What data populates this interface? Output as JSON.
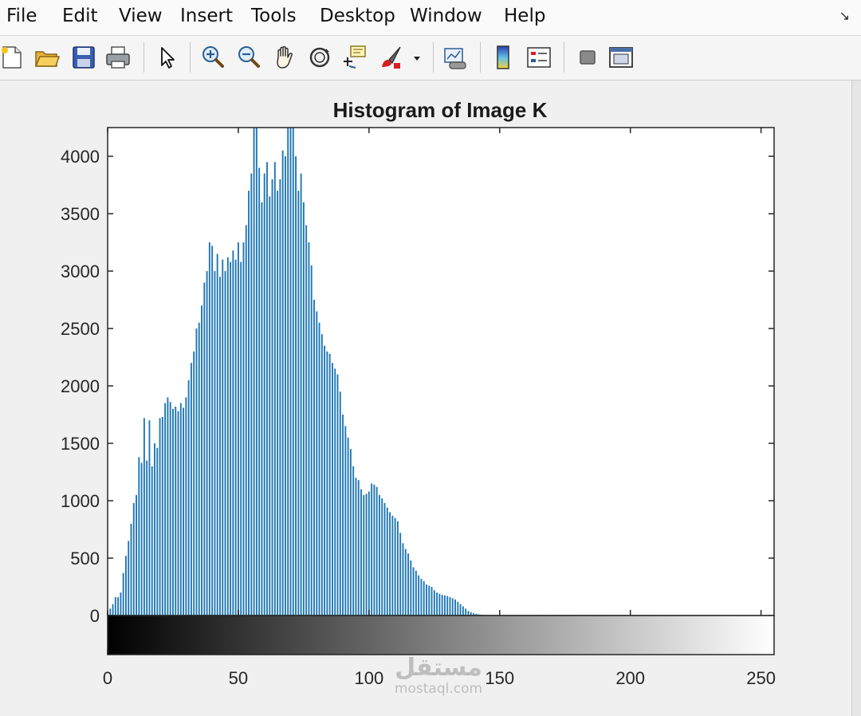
{
  "menubar": {
    "items": [
      "File",
      "Edit",
      "View",
      "Insert",
      "Tools",
      "Desktop",
      "Window",
      "Help"
    ],
    "dock_glyph": "↘"
  },
  "toolbar": {
    "icons": [
      "new-figure-icon",
      "open-file-icon",
      "save-icon",
      "print-icon",
      "edit-plot-arrow-icon",
      "zoom-in-icon",
      "zoom-out-icon",
      "pan-hand-icon",
      "rotate-3d-icon",
      "data-cursor-icon",
      "brush-icon",
      "brush-dropdown-icon",
      "link-plot-icon",
      "insert-colorbar-icon",
      "insert-legend-icon",
      "hide-plot-tools-icon",
      "show-plot-tools-icon"
    ]
  },
  "plot": {
    "title": "Histogram of Image K",
    "bar_color": "#1f77b4",
    "colorbar": "gray"
  },
  "chart_data": {
    "type": "bar",
    "title": "Histogram of Image K",
    "xlabel": "",
    "ylabel": "",
    "xlim": [
      0,
      255
    ],
    "ylim": [
      0,
      4250
    ],
    "xticks": [
      0,
      50,
      100,
      150,
      200,
      250
    ],
    "yticks": [
      0,
      500,
      1000,
      1500,
      2000,
      2500,
      3000,
      3500,
      4000
    ],
    "x": [
      0,
      1,
      2,
      3,
      4,
      5,
      6,
      7,
      8,
      9,
      10,
      11,
      12,
      13,
      14,
      15,
      16,
      17,
      18,
      19,
      20,
      21,
      22,
      23,
      24,
      25,
      26,
      27,
      28,
      29,
      30,
      31,
      32,
      33,
      34,
      35,
      36,
      37,
      38,
      39,
      40,
      41,
      42,
      43,
      44,
      45,
      46,
      47,
      48,
      49,
      50,
      51,
      52,
      53,
      54,
      55,
      56,
      57,
      58,
      59,
      60,
      61,
      62,
      63,
      64,
      65,
      66,
      67,
      68,
      69,
      70,
      71,
      72,
      73,
      74,
      75,
      76,
      77,
      78,
      79,
      80,
      81,
      82,
      83,
      84,
      85,
      86,
      87,
      88,
      89,
      90,
      91,
      92,
      93,
      94,
      95,
      96,
      97,
      98,
      99,
      100,
      101,
      102,
      103,
      104,
      105,
      106,
      107,
      108,
      109,
      110,
      111,
      112,
      113,
      114,
      115,
      116,
      117,
      118,
      119,
      120,
      121,
      122,
      123,
      124,
      125,
      126,
      127,
      128,
      129,
      130,
      131,
      132,
      133,
      134,
      135,
      136,
      137,
      138,
      139,
      140,
      141,
      142,
      143,
      144,
      145,
      146,
      147,
      148,
      149,
      150,
      151,
      152,
      153,
      154,
      155
    ],
    "values": [
      20,
      60,
      100,
      160,
      160,
      200,
      370,
      520,
      650,
      800,
      980,
      1050,
      1380,
      1330,
      1720,
      1350,
      1700,
      1300,
      1500,
      1460,
      1720,
      1730,
      1850,
      1900,
      1860,
      1800,
      1820,
      1780,
      1850,
      1810,
      1900,
      2050,
      2200,
      2300,
      2500,
      2550,
      2700,
      2900,
      3000,
      3250,
      3220,
      3000,
      3150,
      2950,
      3100,
      3000,
      3120,
      3080,
      3180,
      3100,
      3250,
      3080,
      3250,
      3400,
      3700,
      3850,
      4250,
      4250,
      3900,
      3600,
      3850,
      3950,
      3650,
      3800,
      3950,
      3700,
      3800,
      4050,
      4000,
      4250,
      4250,
      4250,
      4000,
      3700,
      3850,
      3600,
      3400,
      3250,
      3050,
      2750,
      2650,
      2550,
      2450,
      2350,
      2300,
      2280,
      2200,
      2150,
      2100,
      1950,
      1750,
      1650,
      1550,
      1450,
      1300,
      1200,
      1180,
      1100,
      1050,
      1060,
      1080,
      1150,
      1140,
      1120,
      1050,
      1020,
      980,
      940,
      900,
      870,
      850,
      820,
      720,
      630,
      580,
      540,
      480,
      420,
      390,
      350,
      320,
      300,
      270,
      260,
      250,
      220,
      200,
      190,
      180,
      175,
      170,
      160,
      150,
      140,
      120,
      100,
      80,
      60,
      40,
      30,
      20,
      15,
      10,
      8,
      5,
      4,
      3,
      2,
      2,
      1,
      1,
      1,
      0,
      0,
      0
    ]
  }
}
